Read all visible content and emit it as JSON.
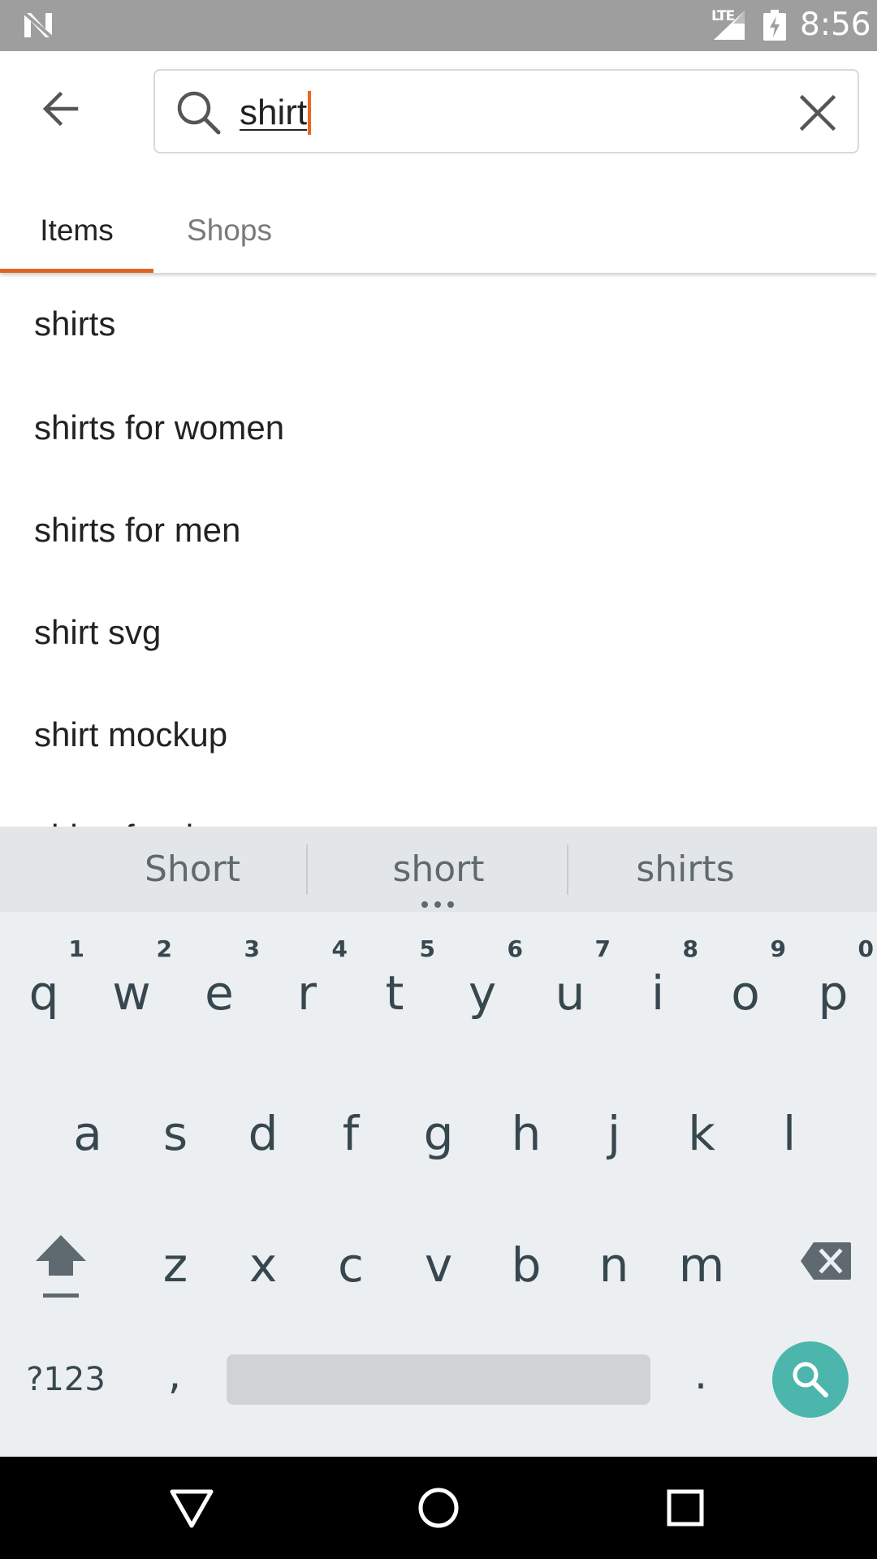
{
  "status_bar": {
    "network": "LTE",
    "time": "8:56"
  },
  "search": {
    "query": "shirt",
    "accent_color": "#f1641e"
  },
  "tabs": [
    {
      "label": "Items",
      "selected": true
    },
    {
      "label": "Shops",
      "selected": false
    }
  ],
  "suggestions": [
    "shirts",
    "shirts for women",
    "shirts for men",
    "shirt svg",
    "shirt mockup",
    "shirts for dogs"
  ],
  "keyboard": {
    "word_suggestions": [
      "Short",
      "short",
      "shirts"
    ],
    "row1": [
      {
        "key": "q",
        "hint": "1"
      },
      {
        "key": "w",
        "hint": "2"
      },
      {
        "key": "e",
        "hint": "3"
      },
      {
        "key": "r",
        "hint": "4"
      },
      {
        "key": "t",
        "hint": "5"
      },
      {
        "key": "y",
        "hint": "6"
      },
      {
        "key": "u",
        "hint": "7"
      },
      {
        "key": "i",
        "hint": "8"
      },
      {
        "key": "o",
        "hint": "9"
      },
      {
        "key": "p",
        "hint": "0"
      }
    ],
    "row2": [
      "a",
      "s",
      "d",
      "f",
      "g",
      "h",
      "j",
      "k",
      "l"
    ],
    "row3": [
      "z",
      "x",
      "c",
      "v",
      "b",
      "n",
      "m"
    ],
    "symbols_label": "?123",
    "comma_label": ",",
    "period_label": ".",
    "search_key_color": "#4db6ac"
  },
  "icons": {
    "back": "arrow-back-icon",
    "search": "search-icon",
    "clear": "close-icon",
    "shift": "shift-icon",
    "delete": "backspace-icon",
    "nav_back": "triangle-back-icon",
    "nav_home": "circle-home-icon",
    "nav_recents": "square-recents-icon"
  }
}
